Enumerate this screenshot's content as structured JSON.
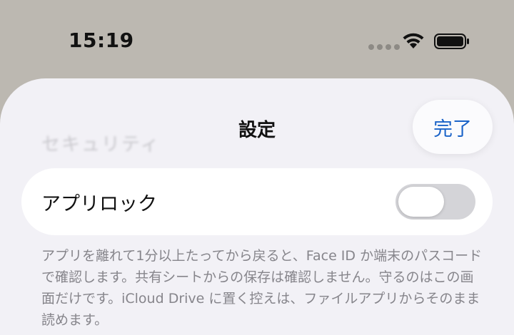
{
  "status_bar": {
    "time": "15:19",
    "icons": [
      "signal-dots-icon",
      "wifi-icon",
      "battery-icon"
    ]
  },
  "sheet": {
    "title": "設定",
    "done_label": "完了",
    "section_header": "セキュリティ",
    "app_lock": {
      "label": "アプリロック",
      "enabled": false
    },
    "footnote": "アプリを離れて1分以上たってから戻ると、Face ID か端末のパスコードで確認します。共有シートからの保存は確認しません。守るのはこの画面だけです。iCloud Drive に置く控えは、ファイルアプリからそのまま読めます。"
  },
  "colors": {
    "accent": "#1a63c8",
    "sheet_background": "#f2f1f6",
    "backdrop": "#bcb8b1",
    "toggle_off": "#d4d4d8"
  }
}
